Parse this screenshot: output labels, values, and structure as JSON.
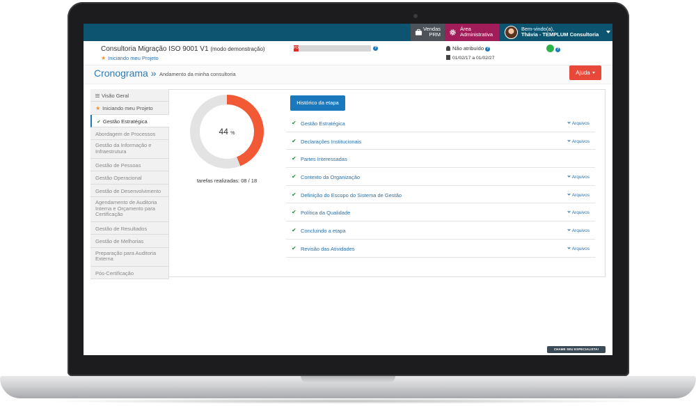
{
  "topbar": {
    "vendas_line1": "Vendas",
    "vendas_line2": "PRM",
    "admin_line1": "Área",
    "admin_line2": "Administrativa",
    "user_greeting": "Bem-vindo(a),",
    "user_name": "Thávia - TEMPLUM Consultoria"
  },
  "project": {
    "title": "Consultoria Migração ISO 9001 V1",
    "mode": "(modo demonstração)",
    "subtitle": "Iniciando meu Projeto",
    "pdf_badge": "PDF",
    "help": "?",
    "assigned": "Não atribuído",
    "dates": "01/02/17 a 01/02/27"
  },
  "page": {
    "title": "Cronograma »",
    "subtitle": "Andamento da minha consultoria",
    "help_button": "Ajuda"
  },
  "sidebar": {
    "items": [
      {
        "label": "Visão Geral"
      },
      {
        "label": "Iniciando meu Projeto"
      },
      {
        "label": "Gestão Estratégica"
      },
      {
        "label": "Abordagem de Processos"
      },
      {
        "label": "Gestão da Informação e Infraestrutura"
      },
      {
        "label": "Gestão de Pessoas"
      },
      {
        "label": "Gestão Operacional"
      },
      {
        "label": "Gestão de Desenvolvimento"
      },
      {
        "label": "Agendamento de Auditoria Interna e Orçamento para Certificação"
      },
      {
        "label": "Gestão de Resultados"
      },
      {
        "label": "Gestão de Melhorias"
      },
      {
        "label": "Preparação para Auditoria Externa"
      },
      {
        "label": "Pós-Certificação"
      }
    ]
  },
  "progress": {
    "percent": 44,
    "percent_value": "44",
    "percent_sign": "%",
    "tasks_label": "tarefas realizadas: 08 / 18",
    "color_done": "#f15a35",
    "color_remaining": "#e3e3e3"
  },
  "steps": {
    "history_button": "Histórico da etapa",
    "files_label": "Arquivos",
    "items": [
      {
        "label": "Gestão Estratégica"
      },
      {
        "label": "Declarações Institucionais"
      },
      {
        "label": "Partes Interessadas"
      },
      {
        "label": "Contexto da Organização"
      },
      {
        "label": "Definição do Escopo do Sistema de Gestão"
      },
      {
        "label": "Política da Qualidade"
      },
      {
        "label": "Concluindo a etapa"
      },
      {
        "label": "Revisão das Atividades"
      }
    ]
  },
  "chat": {
    "label": "CHAME SEU ESPECIALISTA!"
  },
  "colors": {
    "topbar": "#0d5470",
    "vendas": "#4d5258",
    "admin": "#a11d59",
    "accent": "#1a79bd",
    "help_button": "#e8483a",
    "status_ok": "#2db34a"
  }
}
